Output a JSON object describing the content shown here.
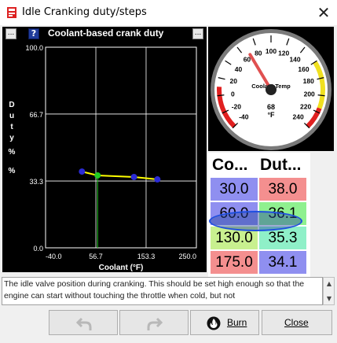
{
  "window": {
    "title": "Idle Cranking duty/steps",
    "close_glyph": "✕"
  },
  "chart_panel": {
    "title": "Coolant-based crank duty",
    "menu_button_label": "...",
    "help_button_label": "?",
    "menu_button_right_label": "..."
  },
  "chart_data": {
    "type": "line",
    "title": "Coolant-based crank duty",
    "xlabel": "Coolant (°F)",
    "ylabel": "Duty % %",
    "ylabel_chars": [
      "D",
      "u",
      "t",
      "y",
      "%",
      "%"
    ],
    "xlim": [
      -40.0,
      250.0
    ],
    "ylim": [
      0.0,
      100.0
    ],
    "x_ticks": [
      "-40.0",
      "56.7",
      "153.3",
      "250.0"
    ],
    "y_ticks": [
      "100.0",
      "66.7",
      "33.3",
      "0.0"
    ],
    "x": [
      30.0,
      60.0,
      130.0,
      175.0
    ],
    "y": [
      38.0,
      36.1,
      35.3,
      34.1
    ],
    "selected_index": 1,
    "line_color": "#ffff00",
    "point_color": "#2b2bd6",
    "selected_point_color": "#22cc22",
    "grid": true
  },
  "gauge": {
    "label": "Coolant Temp",
    "value": "68",
    "unit": "°F",
    "ticks": [
      "-40",
      "-20",
      "0",
      "20",
      "40",
      "60",
      "80",
      "100",
      "120",
      "140",
      "160",
      "180",
      "200",
      "220",
      "240"
    ],
    "min": -40,
    "max": 240,
    "current": 68
  },
  "table": {
    "col1_header": "Co...",
    "col2_header": "Dut...",
    "rows": [
      {
        "coolant": "30.0",
        "duty": "38.0"
      },
      {
        "coolant": "60.0",
        "duty": "36.1"
      },
      {
        "coolant": "130.0",
        "duty": "35.3"
      },
      {
        "coolant": "175.0",
        "duty": "34.1"
      }
    ],
    "colors": {
      "r1c1": "#8f8ff0",
      "r1c2": "#f48f8f",
      "r2c1": "#8f8ff0",
      "r2c2": "#8ff08f",
      "r3c1": "#c8f08f",
      "r3c2": "#8ff0c8",
      "r4c1": "#f48f8f",
      "r4c2": "#8f8ff0"
    }
  },
  "description": {
    "text": "The idle valve position during cranking. This should be set high enough so that the engine can start without touching the throttle when cold, but not"
  },
  "buttons": {
    "burn_label": "Burn",
    "close_label": "Close"
  }
}
